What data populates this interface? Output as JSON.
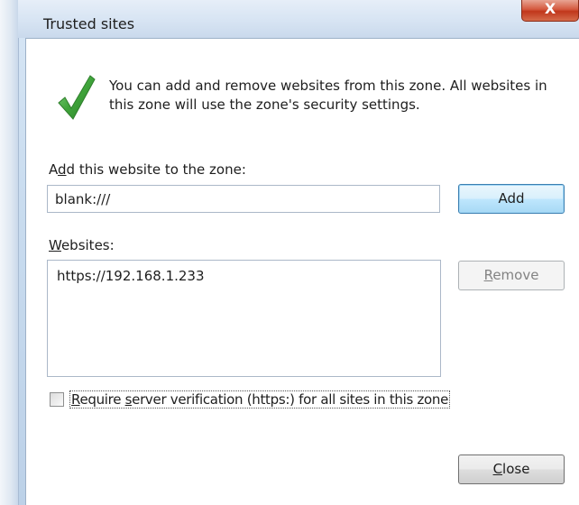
{
  "window": {
    "title": "Trusted sites",
    "close_glyph": "X"
  },
  "info": {
    "icon": "green-checkmark-icon",
    "text": "You can add and remove websites from this zone. All websites in this zone will use the zone's security settings."
  },
  "add_site": {
    "label_prefix": "A",
    "label_mnemonic": "d",
    "label_rest": "d this website to the zone:",
    "input_value": "blank:///",
    "button_label": "Add"
  },
  "websites": {
    "label_mnemonic": "W",
    "label_rest": "ebsites:",
    "items": [
      "https://192.168.1.233"
    ],
    "remove_mnemonic": "R",
    "remove_rest": "emove"
  },
  "verification": {
    "checked": false,
    "label_mnemonic": "R",
    "label_middle": "equire ",
    "label_mnemonic2": "s",
    "label_rest": "erver verification (https:) for all sites in this zone"
  },
  "footer": {
    "close_mnemonic": "C",
    "close_rest": "lose"
  },
  "colors": {
    "accent_button_border": "#3c7fb1",
    "close_button_red": "#c0371b",
    "checkmark_green": "#3fa43a"
  }
}
